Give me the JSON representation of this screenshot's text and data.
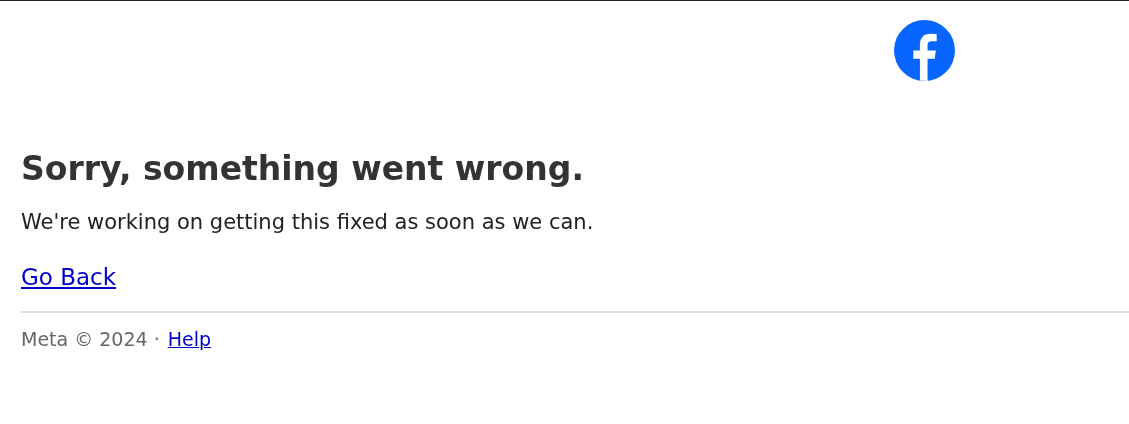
{
  "heading": "Sorry, something went wrong.",
  "message": "We're working on getting this fixed as soon as we can.",
  "back_link": "Go Back",
  "footer": {
    "text": "Meta © 2024 ·",
    "link": "Help"
  }
}
